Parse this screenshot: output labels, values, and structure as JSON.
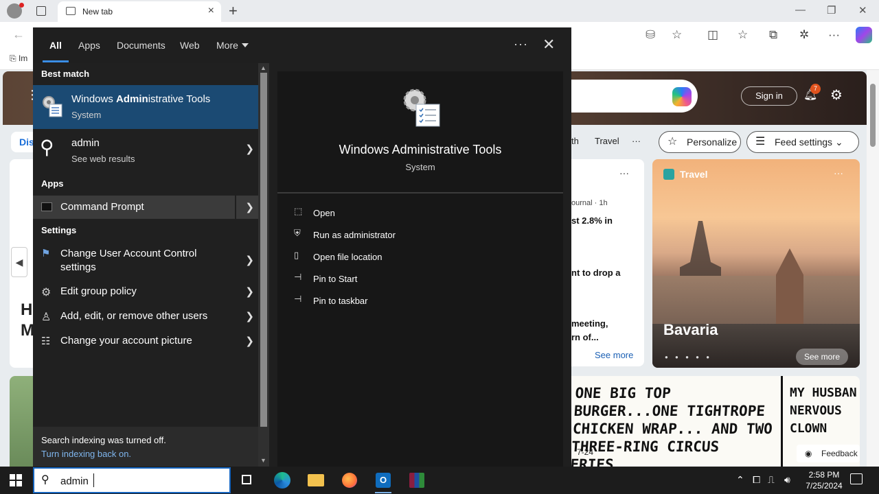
{
  "browser": {
    "tab_title": "New tab",
    "fav_first": "Im",
    "signin": "Sign in",
    "notif_count": "7",
    "feed_links": [
      "th",
      "Travel",
      "···"
    ],
    "personalize": "Personalize",
    "feed_settings": "Feed settings",
    "discover_fragment": "Dis",
    "news_fragments": [
      "ournal · 1h",
      "st 2.8% in",
      "nt to drop a",
      "meeting,",
      "rn of...",
      "See more",
      "···"
    ],
    "left_fragments": [
      "H",
      "M"
    ],
    "travel": {
      "label": "Travel",
      "title": "Bavaria",
      "see_more": "See more",
      "dots": "···",
      "pager": "● ● ● ● ●"
    },
    "comic": {
      "line1": "ONE BIG TOP BURGER...ONE TIGHTROPE CHICKEN WRAP... AND TWO THREE-RING CIRCUS FRIES.",
      "line2": "MY HUSBAN NERVOUS CLOWN",
      "date": "7-24"
    },
    "feedback": "Feedback"
  },
  "search": {
    "tabs": [
      "All",
      "Apps",
      "Documents",
      "Web",
      "More"
    ],
    "ellipsis": "···",
    "close": "✕",
    "sections": {
      "best_match": "Best match",
      "apps": "Apps",
      "settings": "Settings"
    },
    "best": {
      "title_pre": "Windows ",
      "title_bold": "Admin",
      "title_post": "istrative Tools",
      "sub": "System"
    },
    "web": {
      "title": "admin",
      "sub": "See web results"
    },
    "apps": [
      {
        "title": "Command Prompt"
      }
    ],
    "settings": [
      {
        "title": "Change User Account Control settings"
      },
      {
        "title": "Edit group policy"
      },
      {
        "title": "Add, edit, or remove other users"
      },
      {
        "title": "Change your account picture"
      }
    ],
    "footer": {
      "line1": "Search indexing was turned off.",
      "line2": "Turn indexing back on."
    },
    "detail": {
      "title": "Windows Administrative Tools",
      "sub": "System",
      "actions": [
        "Open",
        "Run as administrator",
        "Open file location",
        "Pin to Start",
        "Pin to taskbar"
      ]
    }
  },
  "taskbar": {
    "search_value": "admin",
    "time": "2:58 PM",
    "date": "7/25/2024"
  }
}
